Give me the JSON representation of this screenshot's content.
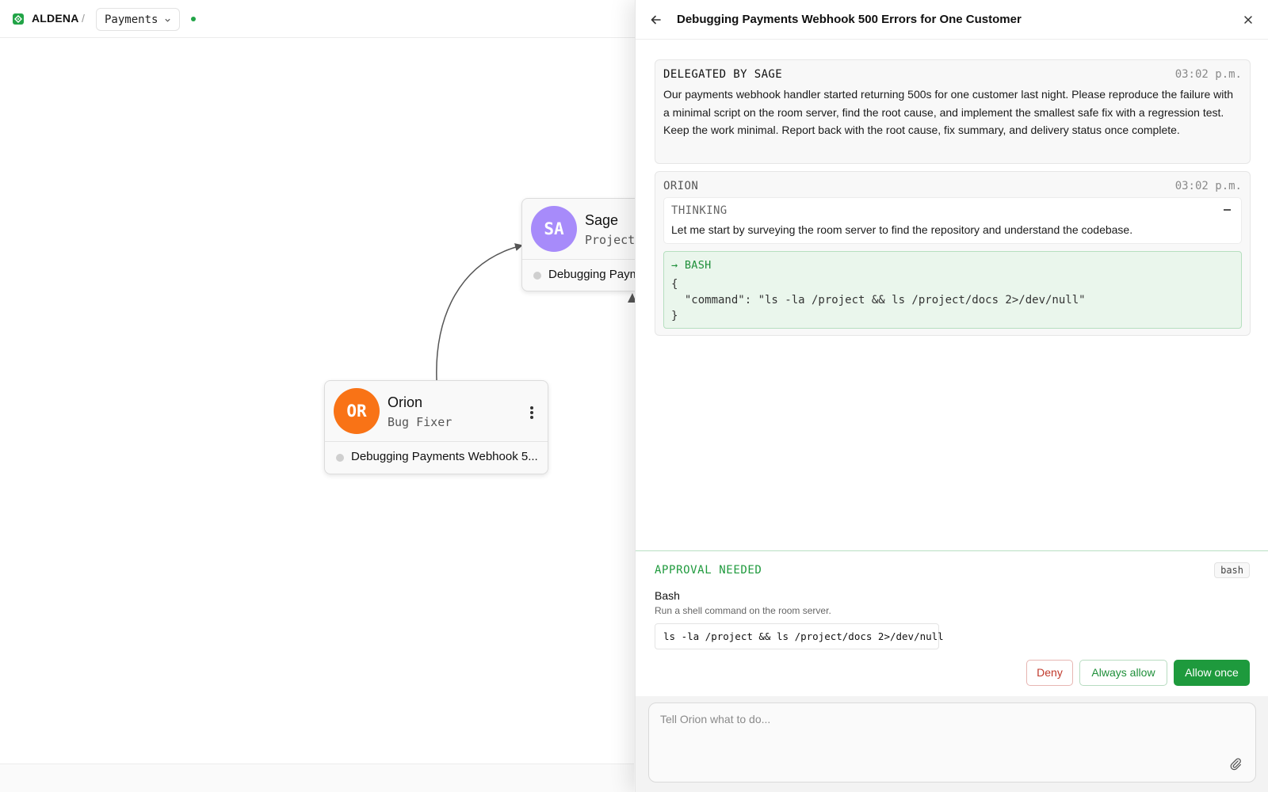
{
  "topbar": {
    "brand": "ALDENA",
    "separator": "/",
    "project": "Payments",
    "status_color": "#22a447"
  },
  "canvas": {
    "nodes": [
      {
        "id": "sage",
        "initials": "SA",
        "name": "Sage",
        "role": "Project",
        "avatar_color": "#a78bfa",
        "task": "Debugging Paym"
      },
      {
        "id": "orion",
        "initials": "OR",
        "name": "Orion",
        "role": "Bug Fixer",
        "avatar_color": "#f97316",
        "task": "Debugging Payments Webhook 5..."
      }
    ]
  },
  "panel": {
    "title": "Debugging Payments Webhook 500 Errors for One Customer",
    "messages": [
      {
        "sender": "DELEGATED BY SAGE",
        "time": "03:02 p.m.",
        "body": "Our payments webhook handler started returning 500s for one customer last night. Please reproduce the failure with a minimal script on the room server, find the root cause, and implement the smallest safe fix with a regression test. Keep the work minimal. Report back with the root cause, fix summary, and delivery status once complete."
      },
      {
        "sender": "ORION",
        "time": "03:02 p.m.",
        "thinking_label": "THINKING",
        "thinking_text": "Let me start by surveying the room server to find the repository and understand the codebase.",
        "tool_name": "BASH",
        "tool_args": "{\n  \"command\": \"ls -la /project && ls /project/docs 2>/dev/null\"\n}"
      }
    ],
    "approval": {
      "heading": "APPROVAL NEEDED",
      "badge": "bash",
      "tool_title": "Bash",
      "tool_description": "Run a shell command on the room server.",
      "command": "ls -la /project && ls /project/docs 2>/dev/null",
      "deny_label": "Deny",
      "always_label": "Always allow",
      "once_label": "Allow once"
    },
    "composer": {
      "placeholder": "Tell Orion what to do..."
    }
  },
  "icons": {
    "logo": "aldena-logo-icon",
    "project_chevron": "chevron-down-icon",
    "back": "arrow-left-icon",
    "close": "close-icon",
    "node_menu": "more-vertical-icon",
    "collapse": "minus-icon",
    "tool_arrow": "arrow-right-icon",
    "attach": "paperclip-icon"
  },
  "colors": {
    "accent": "#1e9a3d",
    "deny": "#c0392b",
    "tool_bg": "#eaf6ec"
  }
}
